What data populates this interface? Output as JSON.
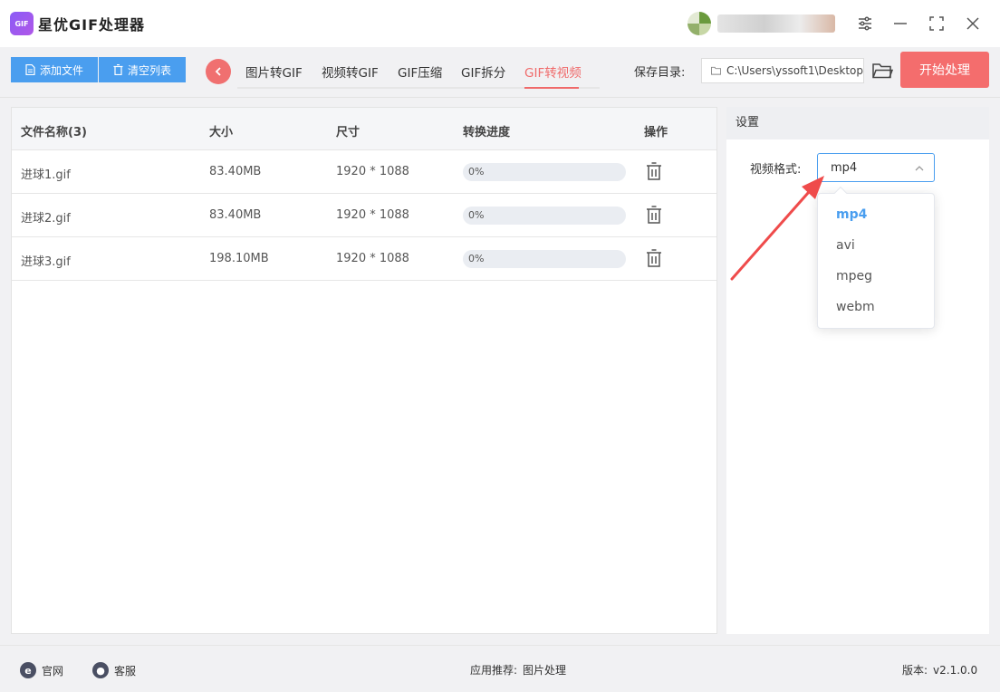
{
  "app": {
    "title": "星优GIF处理器",
    "logo_text": "GIF"
  },
  "toolbar": {
    "add_label": "添加文件",
    "clear_label": "清空列表"
  },
  "tabs": [
    {
      "label": "图片转GIF"
    },
    {
      "label": "视频转GIF"
    },
    {
      "label": "GIF压缩"
    },
    {
      "label": "GIF拆分"
    },
    {
      "label": "GIF转视频",
      "active": true
    }
  ],
  "save": {
    "label": "保存目录:",
    "path": "C:\\Users\\yssoft1\\Desktop"
  },
  "start_label": "开始处理",
  "table": {
    "headers": [
      "文件名称(3)",
      "大小",
      "尺寸",
      "转换进度",
      "操作"
    ],
    "rows": [
      {
        "name": "进球1.gif",
        "size": "83.40MB",
        "dims": "1920 * 1088",
        "progress": "0%",
        "progress_value": 0
      },
      {
        "name": "进球2.gif",
        "size": "83.40MB",
        "dims": "1920 * 1088",
        "progress": "0%",
        "progress_value": 0
      },
      {
        "name": "进球3.gif",
        "size": "198.10MB",
        "dims": "1920 * 1088",
        "progress": "0%",
        "progress_value": 0
      }
    ]
  },
  "settings": {
    "title": "设置",
    "format_label": "视频格式:",
    "format_value": "mp4",
    "options": [
      "mp4",
      "avi",
      "mpeg",
      "webm"
    ]
  },
  "footer": {
    "website": "官网",
    "support": "客服",
    "recommend_label": "应用推荐:",
    "recommend_value": "图片处理",
    "version_label": "版本:",
    "version_value": "v2.1.0.0"
  },
  "colors": {
    "accent": "#4a9eef",
    "danger": "#f46d6d",
    "active_tab": "#f06a6a"
  }
}
